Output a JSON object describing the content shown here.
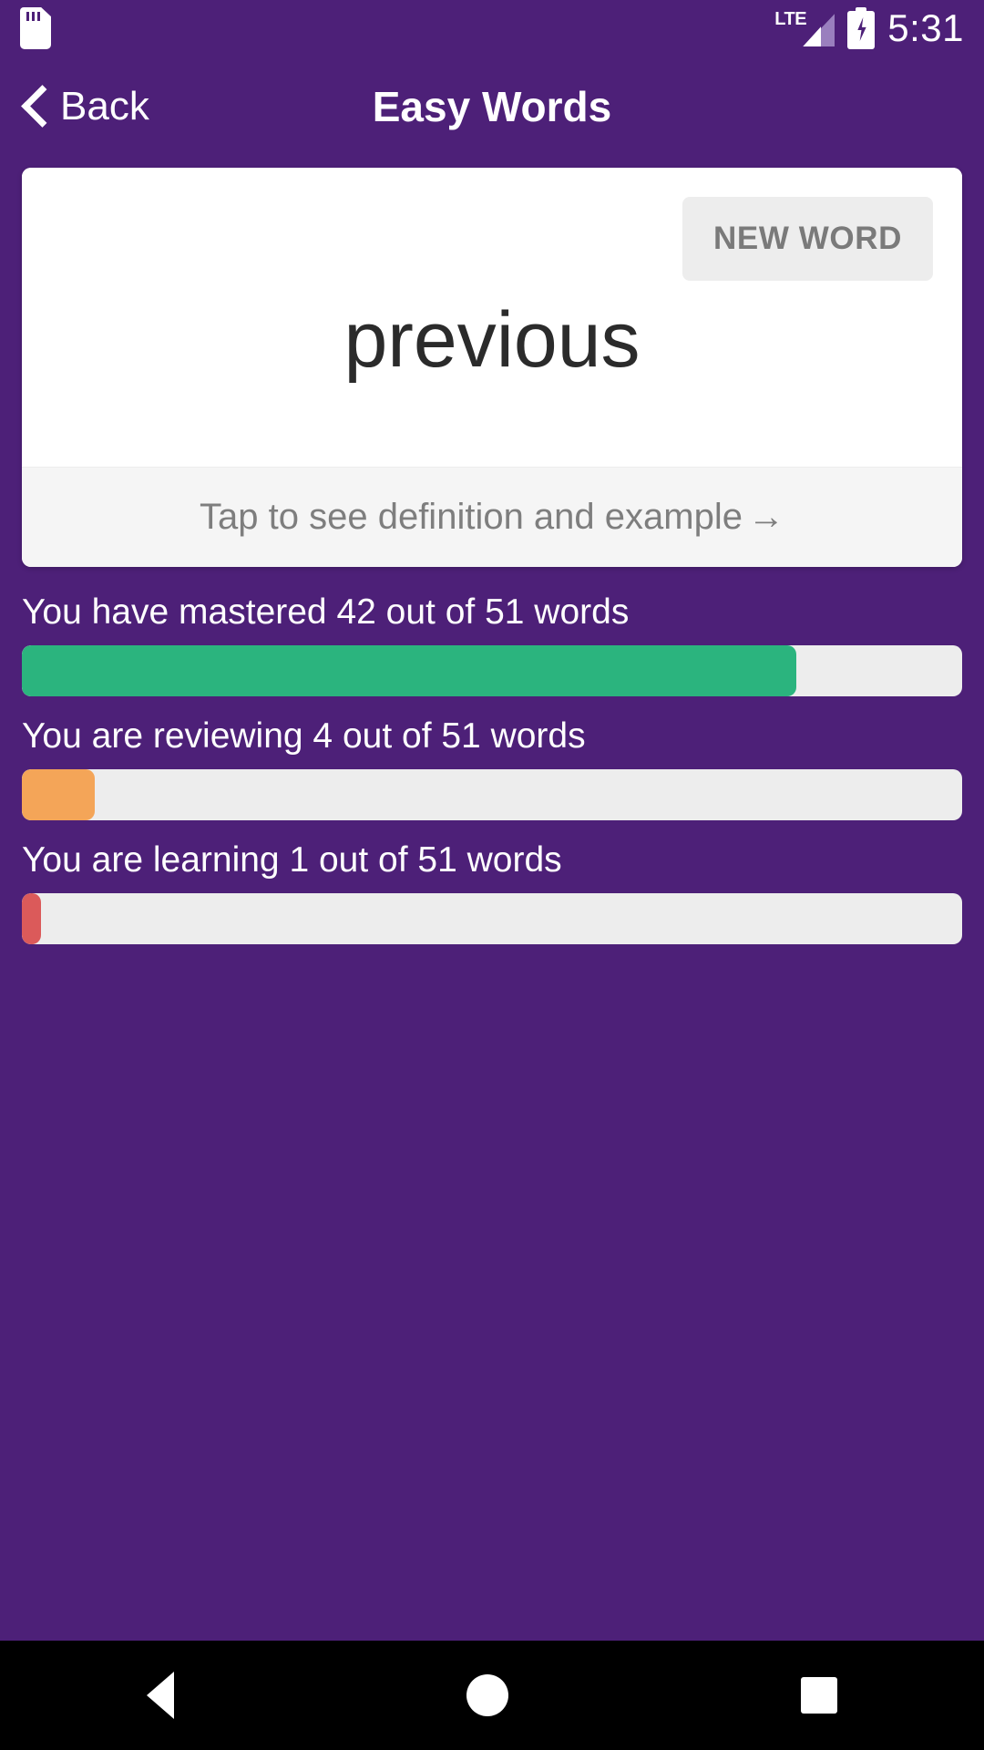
{
  "status_bar": {
    "sd_card_icon": "sd-card-icon",
    "network_label": "LTE",
    "signal_icon": "signal-bars-icon",
    "battery_icon": "battery-charging-icon",
    "time": "5:31"
  },
  "header": {
    "back_icon": "chevron-left-icon",
    "back_label": "Back",
    "title": "Easy Words"
  },
  "card": {
    "new_word_button": "NEW WORD",
    "word": "previous",
    "hint_text": "Tap to see definition and example",
    "hint_arrow": "→"
  },
  "progress": {
    "items": [
      {
        "label": "You have mastered 42 out of 51 words",
        "value": 42,
        "total": 51,
        "percent": 82.4,
        "color": "#2BB47E",
        "name": "mastered"
      },
      {
        "label": "You are reviewing 4 out of 51 words",
        "value": 4,
        "total": 51,
        "percent": 7.8,
        "color": "#F4A558",
        "name": "reviewing"
      },
      {
        "label": "You are learning 1 out of 51 words",
        "value": 1,
        "total": 51,
        "percent": 2.0,
        "color": "#DB5A5A",
        "name": "learning"
      }
    ],
    "track_color": "#EDEDED"
  },
  "nav_bar": {
    "back_icon": "triangle-back-icon",
    "home_icon": "circle-home-icon",
    "recents_icon": "square-recents-icon"
  },
  "theme": {
    "background": "#4D2078",
    "card_background": "#FFFFFF",
    "card_footer_background": "#F5F5F5"
  }
}
